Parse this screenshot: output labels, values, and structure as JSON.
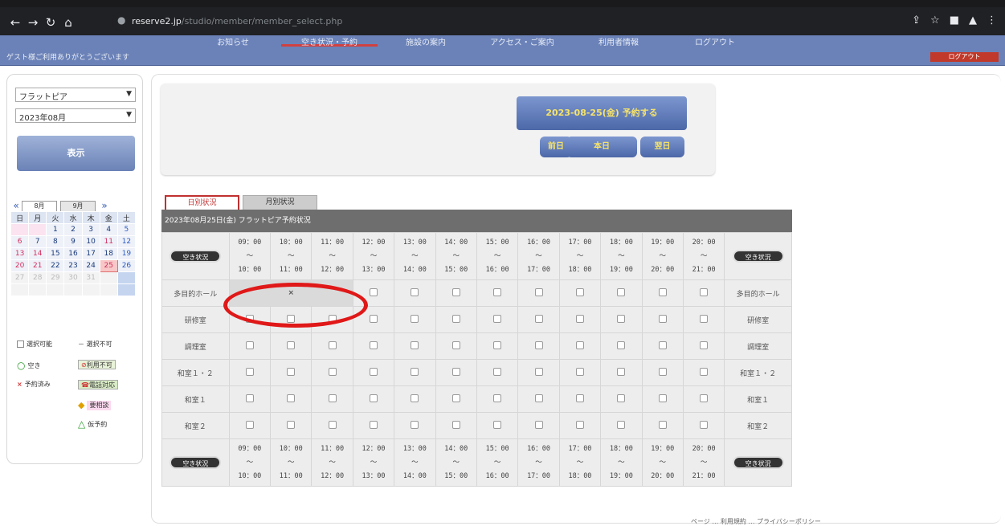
{
  "browser": {
    "url_domain": "reserve2.jp",
    "url_path": "/studio/member/member_select.php",
    "nav_icons": [
      "back-arrow-icon",
      "forward-arrow-icon",
      "reload-icon",
      "home-icon"
    ],
    "right_icons": [
      "share-icon",
      "star-icon",
      "sidepanel-icon",
      "profile-icon",
      "menu-icon"
    ]
  },
  "header": {
    "menu": [
      "お知らせ",
      "空き状況・予約",
      "施設の案内",
      "アクセス・ご案内",
      "利用者情報",
      "ログアウト"
    ],
    "welcome": "ゲスト様ご利用ありがとうございます",
    "badge": "ログアウト"
  },
  "sidebar": {
    "facility_select": "フラットピア",
    "month_select": "2023年08月",
    "show_button": "表示",
    "calendar": {
      "tabs": [
        "8月",
        "9月"
      ],
      "weekdays": [
        "日",
        "月",
        "火",
        "水",
        "木",
        "金",
        "土"
      ],
      "weeks": [
        [
          "",
          "",
          "1",
          "2",
          "3",
          "4",
          "5"
        ],
        [
          "6",
          "7",
          "8",
          "9",
          "10",
          "11",
          "12"
        ],
        [
          "13",
          "14",
          "15",
          "16",
          "17",
          "18",
          "19"
        ],
        [
          "20",
          "21",
          "22",
          "23",
          "24",
          "25",
          "26"
        ],
        [
          "27",
          "28",
          "29",
          "30",
          "31",
          "",
          ""
        ]
      ]
    },
    "legend": {
      "available": "選択可能",
      "unselectable": "－ 選択不可",
      "vacant": "空き",
      "not_usable": "利用不可",
      "reserved": "予約済み",
      "phone": "電話対応",
      "consult": "要相談",
      "provisional": "仮予約"
    }
  },
  "main": {
    "reserve_button": "2023-08-25(金) 予約する",
    "prev_day": "前日",
    "today": "本日",
    "next_day": "翌日",
    "tab_daily": "日別状況",
    "tab_monthly": "月別状況",
    "table_title": "2023年08月25日(金) フラットピア予約状況",
    "status_button": "空き状況",
    "time_slots": [
      {
        "start": "09：00",
        "end": "10：00"
      },
      {
        "start": "10：00",
        "end": "11：00"
      },
      {
        "start": "11：00",
        "end": "12：00"
      },
      {
        "start": "12：00",
        "end": "13：00"
      },
      {
        "start": "13：00",
        "end": "14：00"
      },
      {
        "start": "14：00",
        "end": "15：00"
      },
      {
        "start": "15：00",
        "end": "16：00"
      },
      {
        "start": "16：00",
        "end": "17：00"
      },
      {
        "start": "17：00",
        "end": "18：00"
      },
      {
        "start": "18：00",
        "end": "19：00"
      },
      {
        "start": "19：00",
        "end": "20：00"
      },
      {
        "start": "20：00",
        "end": "21：00"
      }
    ],
    "tilde": "～",
    "rooms": [
      "多目的ホール",
      "研修室",
      "調理室",
      "和室１・２",
      "和室１",
      "和室２"
    ],
    "reserved_mark": "×"
  },
  "footer": {
    "text": "ページ … 利用規約 … プライバシーポリシー"
  },
  "colors": {
    "header_blue": "#6b82b8",
    "button_text_yellow": "#f6e36a",
    "annotation_red": "#e01818"
  }
}
